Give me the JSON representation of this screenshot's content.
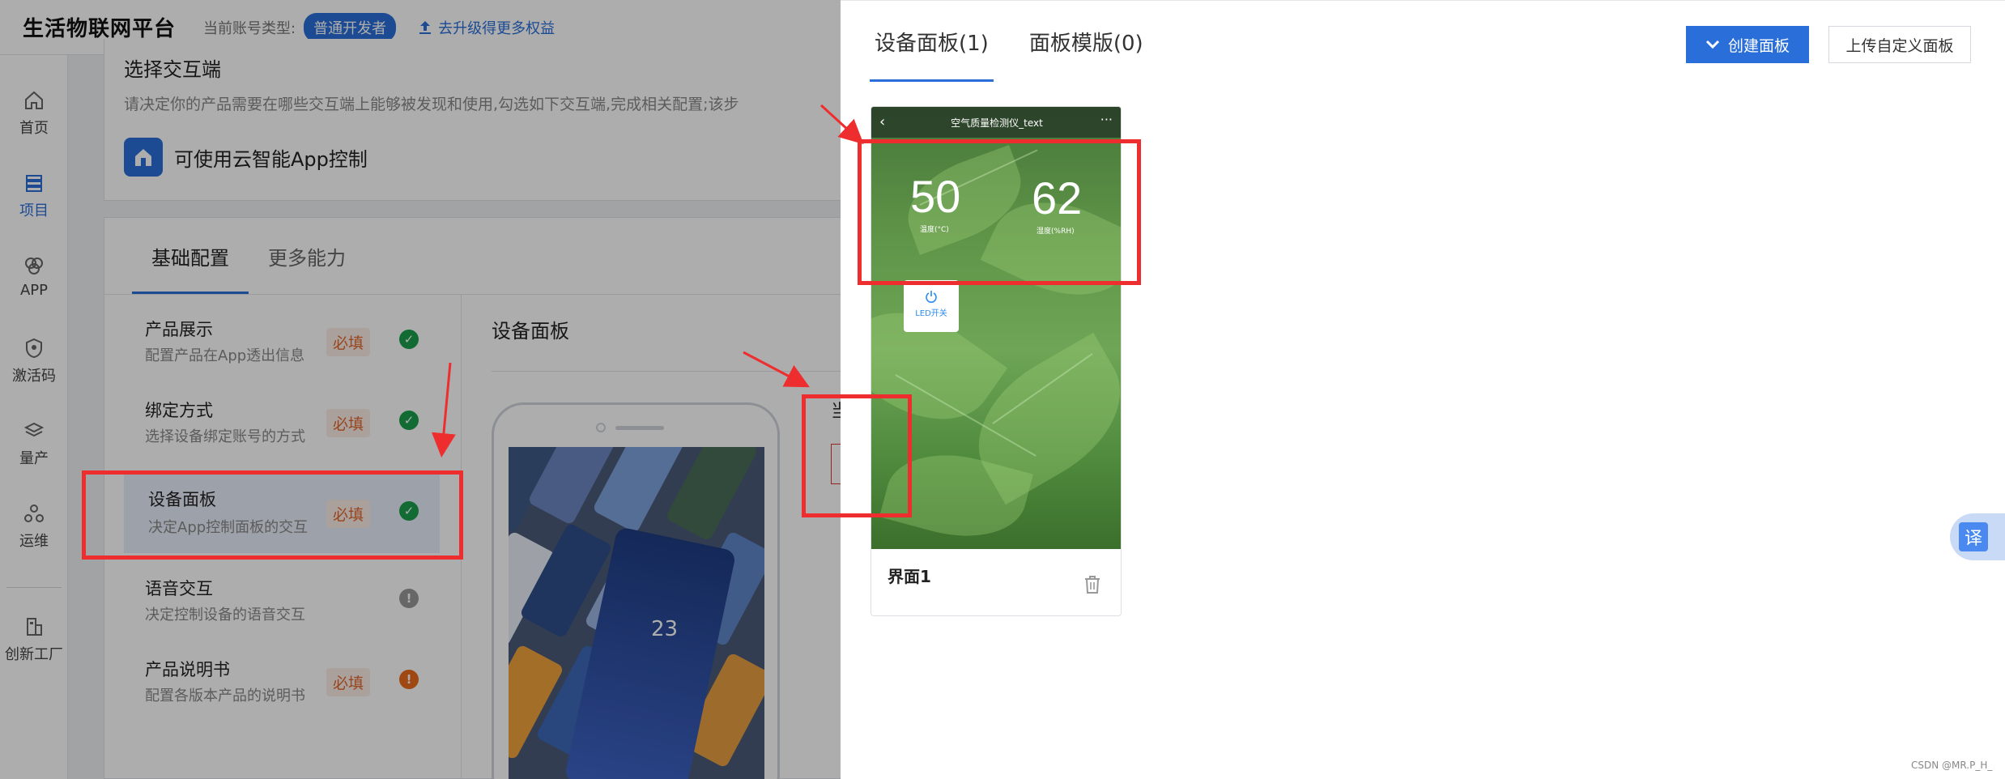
{
  "header": {
    "brand": "生活物联网平台",
    "account_type_label": "当前账号类型:",
    "account_type_badge": "普通开发者",
    "upgrade_link": "去升级得更多权益"
  },
  "sidebar": {
    "items": [
      {
        "label": "首页",
        "icon": "home-icon"
      },
      {
        "label": "项目",
        "icon": "project-icon"
      },
      {
        "label": "APP",
        "icon": "app-icon"
      },
      {
        "label": "激活码",
        "icon": "shield-icon"
      },
      {
        "label": "量产",
        "icon": "layers-icon"
      },
      {
        "label": "运维",
        "icon": "ops-icon"
      },
      {
        "label": "创新工厂",
        "icon": "factory-icon"
      }
    ]
  },
  "interaction_section": {
    "title": "选择交互端",
    "description": "请决定你的产品需要在哪些交互端上能够被发现和使用,勾选如下交互端,完成相关配置;该步",
    "app_option": "可使用云智能App控制"
  },
  "config_tabs": [
    "基础配置",
    "更多能力"
  ],
  "steps": [
    {
      "title": "产品展示",
      "desc": "配置产品在App透出信息",
      "badge": "必填",
      "status": "ok"
    },
    {
      "title": "绑定方式",
      "desc": "选择设备绑定账号的方式",
      "badge": "必填",
      "status": "ok"
    },
    {
      "title": "设备面板",
      "desc": "决定App控制面板的交互",
      "badge": "必填",
      "status": "ok"
    },
    {
      "title": "语音交互",
      "desc": "决定控制设备的语音交互",
      "badge": "",
      "status": "warn"
    },
    {
      "title": "产品说明书",
      "desc": "配置各版本产品的说明书",
      "badge": "必填",
      "status": "err"
    }
  ],
  "panel_section_title": "设备面板",
  "phone_preview_value": "23",
  "background_fragment": "当",
  "drawer": {
    "tabs": [
      "设备面板(1)",
      "面板模版(0)"
    ],
    "create_button": "创建面板",
    "upload_button": "上传自定义面板",
    "panel_card": {
      "preview_title": "空气质量检测仪_text",
      "metric1_value": "50",
      "metric1_label": "温度(°C)",
      "metric2_value": "62",
      "metric2_label": "湿度(%RH)",
      "led_label": "LED开关",
      "name": "界面1"
    }
  },
  "translate_button": "译",
  "watermark": "CSDN @MR.P_H_",
  "colors": {
    "accent": "#2a6fd9",
    "annotation": "#ee2e2e",
    "ok": "#1a9e4b",
    "warn": "#999999",
    "err": "#ec6a1a"
  }
}
